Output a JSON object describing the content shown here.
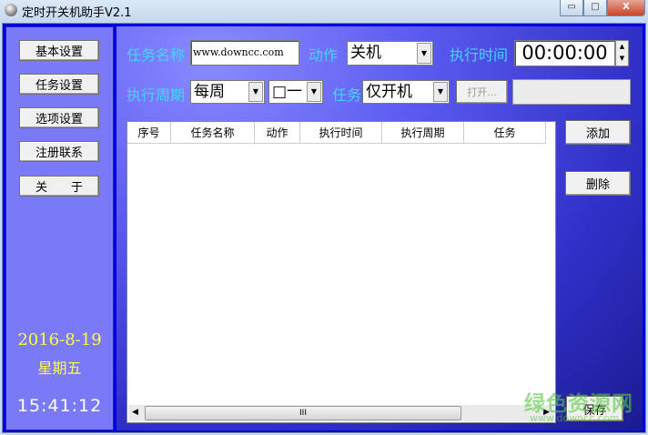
{
  "window": {
    "title": "定时开关机助手V2.1",
    "min": "▭",
    "max": "□",
    "close": "X"
  },
  "sidebar": {
    "buttons": [
      "基本设置",
      "任务设置",
      "选项设置",
      "注册联系",
      "关　　于"
    ],
    "date": "2016-8-19",
    "weekday": "星期五",
    "time": "15:41:12"
  },
  "form": {
    "task_name_label": "任务名称",
    "task_name_value": "www.downcc.com",
    "action_label": "动作",
    "action_value": "关机",
    "exec_time_label": "执行时间",
    "exec_time_value": "00:00:00",
    "cycle_label": "执行周期",
    "cycle_value": "每周",
    "day_value": "□一",
    "task_label": "任务",
    "task_value": "仅开机",
    "open_button": "打开...",
    "open_path": ""
  },
  "table": {
    "columns": [
      "序号",
      "任务名称",
      "动作",
      "执行时间",
      "执行周期",
      "任务"
    ],
    "rows": [],
    "scroll_thumb": "III"
  },
  "actions": {
    "add": "添加",
    "delete": "删除",
    "save": "保存"
  },
  "watermark": {
    "text": "绿色资源网",
    "url": "www.downcc.com"
  },
  "colors": {
    "label": "#3fd8f8",
    "date": "#ffff40",
    "panel": "#7a7af6"
  }
}
